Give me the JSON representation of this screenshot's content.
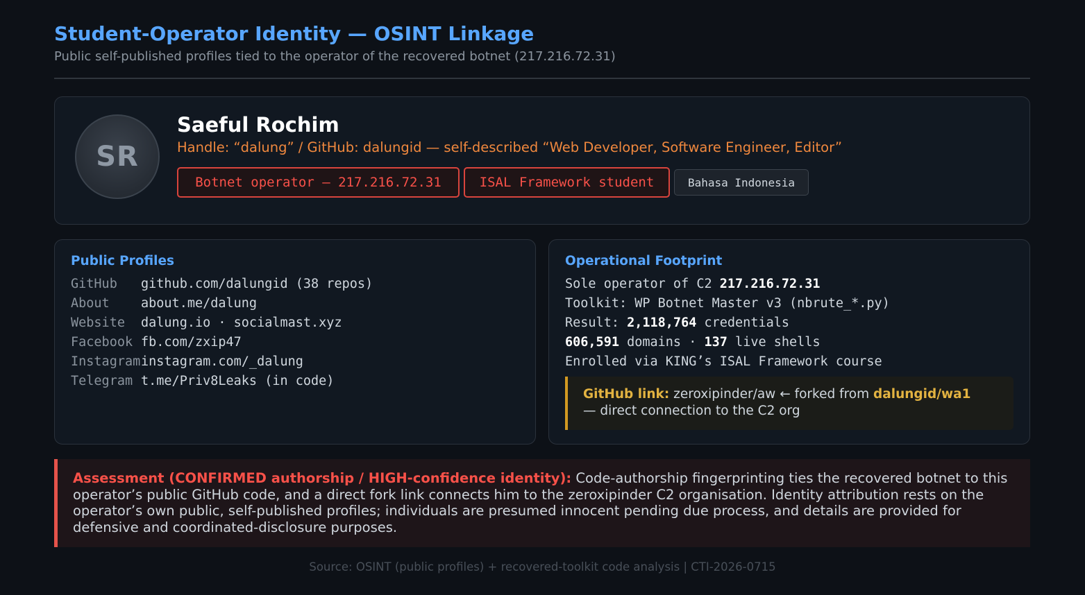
{
  "header": {
    "title": "Student-Operator Identity — OSINT Linkage",
    "subtitle": "Public self-published profiles tied to the operator of the recovered botnet (217.216.72.31)"
  },
  "profile": {
    "avatar_initials": "SR",
    "name": "Saeful Rochim",
    "handle": "Handle: “dalung” / GitHub: dalungid — self-described “Web Developer, Software Engineer, Editor”",
    "tags": [
      "Botnet operator — 217.216.72.31",
      "ISAL Framework student",
      "Bahasa Indonesia"
    ]
  },
  "public_profiles": {
    "heading": "Public Profiles",
    "rows": [
      {
        "key": "GitHub",
        "value": "github.com/dalungid (38 repos)"
      },
      {
        "key": "About",
        "value": "about.me/dalung"
      },
      {
        "key": "Website",
        "value": "dalung.io · socialmast.xyz"
      },
      {
        "key": "Facebook",
        "value": "fb.com/zxip47"
      },
      {
        "key": "Instagram",
        "value": "instagram.com/_dalung"
      },
      {
        "key": "Telegram",
        "value": "t.me/Priv8Leaks (in code)"
      }
    ]
  },
  "footprint": {
    "heading": "Operational Footprint",
    "line1_prefix": "Sole operator of C2 ",
    "line1_bold": "217.216.72.31",
    "line2": "Toolkit: WP Botnet Master v3 (nbrute_*.py)",
    "line3_prefix": "Result: ",
    "line3_bold": "2,118,764",
    "line3_suffix": " credentials",
    "line4_bold1": "606,591",
    "line4_mid": " domains · ",
    "line4_bold2": "137",
    "line4_suffix": " live shells",
    "line5": "Enrolled via KING’s ISAL Framework course",
    "github_link": {
      "label": "GitHub link:",
      "text1": " zeroxipinder/aw ← forked from ",
      "repo": "dalungid/wa1",
      "text2": "— direct connection to the C2 org"
    }
  },
  "assessment": {
    "label": "Assessment (CONFIRMED authorship / HIGH-confidence identity):",
    "text": " Code-authorship fingerprinting ties the recovered botnet to this operator’s public GitHub code, and a direct fork link connects him to the zeroxipinder C2 organisation. Identity attribution rests on the operator’s own public, self-published profiles; individuals are presumed innocent pending due process, and details are provided for defensive and coordinated-disclosure purposes."
  },
  "footer": {
    "source": "Source: OSINT (public profiles) + recovered-toolkit code analysis | CTI-2026-0715"
  },
  "colors": {
    "background": "#0d1117",
    "accent_blue": "#58a6ff",
    "accent_orange": "#f0883e",
    "alert_red": "#f85149",
    "gold": "#e3b341"
  }
}
